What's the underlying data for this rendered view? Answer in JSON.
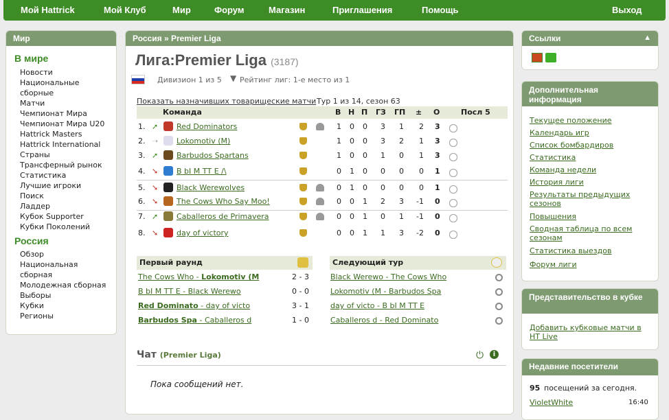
{
  "topnav": {
    "my_hattrick": "Мой Hattrick",
    "my_club": "Мой Клуб",
    "world": "Мир",
    "forum": "Форум",
    "shop": "Магазин",
    "invites": "Приглашения",
    "help": "Помощь",
    "logout": "Выход"
  },
  "left": {
    "title": "Мир",
    "sec1": "В мире",
    "items1": [
      "Новости",
      "Национальные",
      "сборные",
      "Матчи",
      "Чемпионат Мира",
      "Чемпионат Мира U20",
      "Hattrick Masters",
      "Hattrick International",
      "Страны",
      "Трансферный рынок",
      "Статистика",
      "Лучшие игроки",
      "Поиск",
      "Ладдер",
      "Кубок Supporter",
      "Кубки Поколений"
    ],
    "sec2": "Россия",
    "items2": [
      "Обзор",
      "Национальная",
      "сборная",
      "Молодежная сборная",
      "Выборы",
      "Кубки",
      "Регионы"
    ]
  },
  "center": {
    "breadcrumb": "Россия  »  Premier Liga",
    "title": "Лига:Premier Liga",
    "title_id": "(3187)",
    "division": "Дивизион 1 из 5",
    "rating": "Рейтинг лиг: 1-е место из 1",
    "friendly_link": "Показать назначивших товарищеские матчи",
    "round_info": "Тур 1 из 14, сезон 63",
    "table_headers": {
      "team": "Команда",
      "w": "В",
      "d": "Н",
      "l": "П",
      "gf": "ГЗ",
      "ga": "ГП",
      "diff": "±",
      "pts": "О",
      "last5": "Посл 5"
    },
    "rows": [
      {
        "pos": "1.",
        "team": "Red Dominators",
        "w": "1",
        "d": "0",
        "l": "0",
        "gf": "3",
        "ga": "1",
        "diff": "2",
        "pts": "3",
        "res": "w",
        "trend": "up",
        "extra": true,
        "badge": "#c0392b"
      },
      {
        "pos": "2.",
        "team": "Lokomotiv (M)",
        "w": "1",
        "d": "0",
        "l": "0",
        "gf": "3",
        "ga": "2",
        "diff": "1",
        "pts": "3",
        "res": "w",
        "trend": "same",
        "extra": false,
        "badge": "#dde"
      },
      {
        "pos": "3.",
        "team": "Barbudos Spartans",
        "w": "1",
        "d": "0",
        "l": "0",
        "gf": "1",
        "ga": "0",
        "diff": "1",
        "pts": "3",
        "res": "w",
        "trend": "up",
        "extra": false,
        "badge": "#6b4a1e"
      },
      {
        "pos": "4.",
        "team": "В bI М ТТ Е /\\",
        "w": "0",
        "d": "1",
        "l": "0",
        "gf": "0",
        "ga": "0",
        "diff": "0",
        "pts": "1",
        "res": "d",
        "trend": "down",
        "extra": false,
        "badge": "#2e7dd1"
      },
      {
        "pos": "5.",
        "team": "Black Werewolves",
        "w": "0",
        "d": "1",
        "l": "0",
        "gf": "0",
        "ga": "0",
        "diff": "0",
        "pts": "1",
        "res": "d",
        "trend": "down",
        "extra": true,
        "badge": "#222"
      },
      {
        "pos": "6.",
        "team": "The Cows Who Say Moo!",
        "w": "0",
        "d": "0",
        "l": "1",
        "gf": "2",
        "ga": "3",
        "diff": "-1",
        "pts": "0",
        "res": "l",
        "trend": "down",
        "extra": true,
        "badge": "#b5651d"
      },
      {
        "pos": "7.",
        "team": "Caballeros de Primavera",
        "w": "0",
        "d": "0",
        "l": "1",
        "gf": "0",
        "ga": "1",
        "diff": "-1",
        "pts": "0",
        "res": "l",
        "trend": "up",
        "extra": true,
        "badge": "#8a7a3a"
      },
      {
        "pos": "8.",
        "team": "day of victory",
        "w": "0",
        "d": "0",
        "l": "1",
        "gf": "1",
        "ga": "3",
        "diff": "-2",
        "pts": "0",
        "res": "l",
        "trend": "down",
        "extra": false,
        "badge": "#c22"
      }
    ],
    "first_round": "Первый раунд",
    "first_matches": [
      {
        "home": "The Cows Who",
        "away": "Lokomotiv (M",
        "score": "2 - 3",
        "win": "away"
      },
      {
        "home": "В bI М ТТ Е",
        "away": "Black Werewo",
        "score": "0 - 0",
        "win": "none"
      },
      {
        "home": "Red Dominato",
        "away": "day of victo",
        "score": "3 - 1",
        "win": "home"
      },
      {
        "home": "Barbudos Spa",
        "away": "Caballeros d",
        "score": "1 - 0",
        "win": "home"
      }
    ],
    "next_round": "Следующий тур",
    "next_matches": [
      {
        "home": "Black Werewo",
        "away": "The Cows Who"
      },
      {
        "home": "Lokomotiv (M",
        "away": "Barbudos Spa"
      },
      {
        "home": "day of victo",
        "away": "В bI М ТТ Е"
      },
      {
        "home": "Caballeros d",
        "away": "Red Dominato"
      }
    ],
    "chat": "Чат",
    "chat_league": "(Premier Liga)",
    "chat_empty": "Пока сообщений нет."
  },
  "right": {
    "links_title": "Ссылки",
    "info_title": "Дополнительная информация",
    "info_links": [
      "Текущее положение",
      "Календарь игр",
      "Список бомбардиров",
      "Статистика",
      "Команда недели",
      "История лиги",
      "Результаты предыдущих сезонов",
      "Повышения",
      "Сводная таблица по всем сезонам",
      "Статистика выездов",
      "Форум лиги"
    ],
    "rep_title": "Представительство в кубке",
    "rep_link": "Добавить кубковые матчи в HT Live",
    "visitors_title": "Недавние посетители",
    "visitors_count": "95",
    "visitors_text": "посещений за сегодня.",
    "visitor_name": "VioletWhite",
    "visitor_time": "16:40"
  },
  "colors": {
    "nav": "#3d8c26",
    "panel_head": "#7e9a70",
    "link": "#3a6b1f"
  }
}
